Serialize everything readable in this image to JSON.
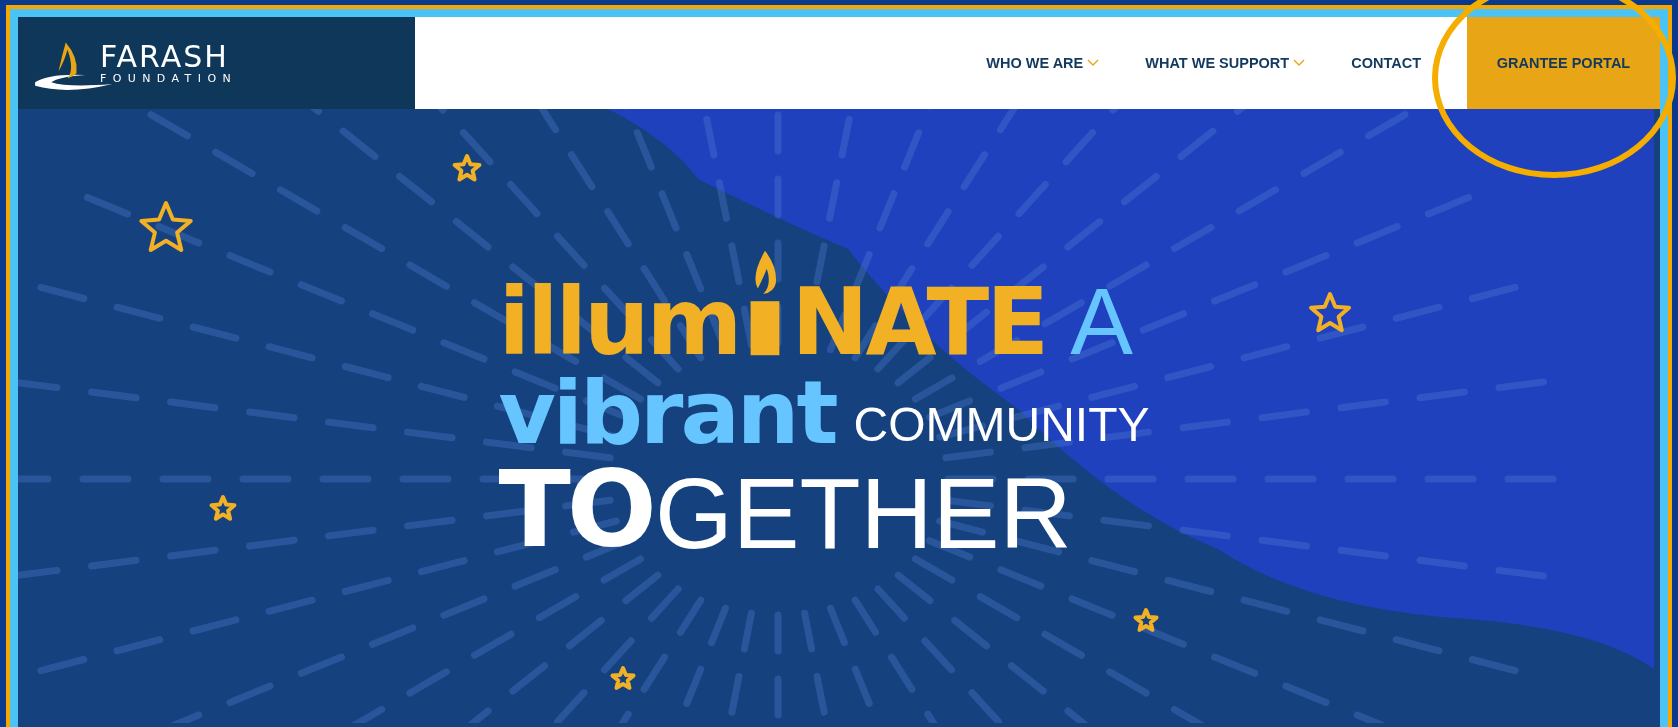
{
  "logo": {
    "name": "FARASH",
    "tagline": "FOUNDATION"
  },
  "nav": [
    {
      "label": "WHO WE ARE",
      "kind": "dropdown"
    },
    {
      "label": "WHAT WE SUPPORT",
      "kind": "dropdown"
    },
    {
      "label": "CONTACT",
      "kind": "link"
    },
    {
      "label": "GRANTEE PORTAL",
      "kind": "cta"
    }
  ],
  "highlight_circle": true,
  "headline": [
    [
      {
        "text": "illum",
        "kind": "heavy"
      },
      {
        "text": "NATE",
        "kind": "heavy"
      },
      {
        "text": "A",
        "kind": "plain"
      }
    ],
    [
      {
        "text": "vibrant",
        "kind": "heavy"
      },
      {
        "text": "COMMUNITY",
        "kind": "plain"
      }
    ],
    [
      {
        "text": "TO",
        "kind": "heavy"
      },
      {
        "text": "GETHER",
        "kind": "plain"
      }
    ]
  ]
}
